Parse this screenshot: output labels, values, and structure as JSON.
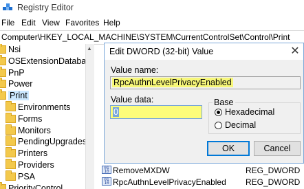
{
  "window": {
    "title": "Registry Editor"
  },
  "menu": [
    "File",
    "Edit",
    "View",
    "Favorites",
    "Help"
  ],
  "address": "Computer\\HKEY_LOCAL_MACHINE\\SYSTEM\\CurrentControlSet\\Control\\Print",
  "tree": {
    "items": [
      {
        "label": "Nsi",
        "indent": 0
      },
      {
        "label": "OSExtensionDatabase",
        "indent": 0
      },
      {
        "label": "PnP",
        "indent": 0
      },
      {
        "label": "Power",
        "indent": 0
      },
      {
        "label": "Print",
        "indent": 0,
        "selected": true
      },
      {
        "label": "Environments",
        "indent": 1
      },
      {
        "label": "Forms",
        "indent": 1
      },
      {
        "label": "Monitors",
        "indent": 1
      },
      {
        "label": "PendingUpgrades",
        "indent": 1
      },
      {
        "label": "Printers",
        "indent": 1
      },
      {
        "label": "Providers",
        "indent": 1
      },
      {
        "label": "PSA",
        "indent": 1
      },
      {
        "label": "PriorityControl",
        "indent": 0
      }
    ]
  },
  "values": [
    {
      "name": "RemoveMXDW",
      "type": "REG_DWORD",
      "icon": "binary-value-icon"
    },
    {
      "name": "RpcAuthnLevelPrivacyEnabled",
      "type": "REG_DWORD",
      "icon": "binary-value-icon"
    }
  ],
  "dialog": {
    "title": "Edit DWORD (32-bit) Value",
    "close_glyph": "✕",
    "value_name_label": "Value name:",
    "value_name": "RpcAuthnLevelPrivacyEnabled",
    "value_data_label": "Value data:",
    "value_data": "0",
    "base_label": "Base",
    "radio_hex": "Hexadecimal",
    "radio_dec": "Decimal",
    "base_selected": "Hexadecimal",
    "ok_label": "OK",
    "cancel_label": "Cancel"
  },
  "colors": {
    "highlight": "#f7f779",
    "selection": "#cce8ff",
    "accent": "#0078d7"
  }
}
